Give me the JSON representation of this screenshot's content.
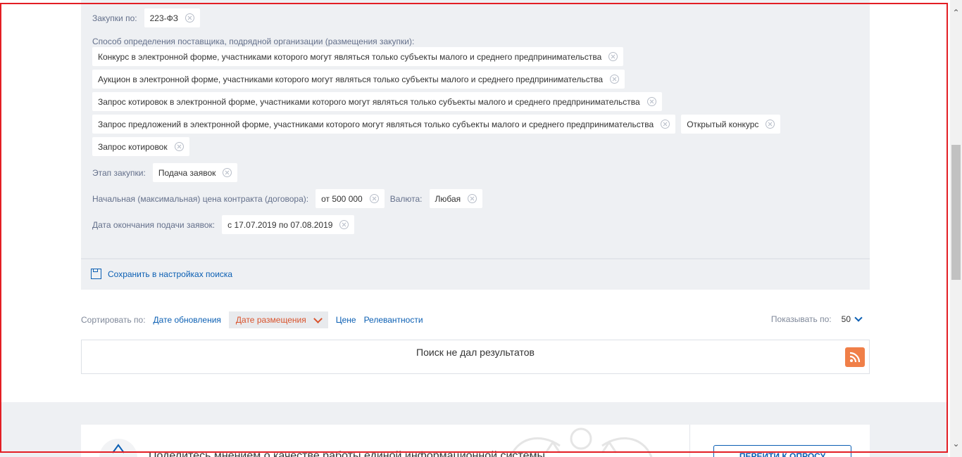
{
  "filters": {
    "purchases_label": "Закупки по:",
    "purchases_chip": "223-ФЗ",
    "method_label": "Способ определения поставщика, подрядной организации (размещения закупки):",
    "method_chips": [
      "Конкурс в электронной форме, участниками которого могут являться только субъекты малого и среднего предпринимательства",
      "Аукцион в электронной форме, участниками которого могут являться только субъекты малого и среднего предпринимательства",
      "Запрос котировок в электронной форме, участниками которого могут являться только субъекты малого и среднего предпринимательства",
      "Запрос предложений в электронной форме, участниками которого могут являться только субъекты малого и среднего предпринимательства",
      "Открытый конкурс",
      "Запрос котировок"
    ],
    "stage_label": "Этап закупки:",
    "stage_chip": "Подача заявок",
    "price_label": "Начальная (максимальная) цена контракта (договора):",
    "price_chip": "от 500 000",
    "currency_label": "Валюта:",
    "currency_chip": "Любая",
    "deadline_label": "Дата окончания подачи заявок:",
    "deadline_chip": "с 17.07.2019 по 07.08.2019",
    "save_link": "Сохранить в настройках поиска"
  },
  "sort": {
    "label": "Сортировать по:",
    "options": [
      "Дате обновления",
      "Дате размещения",
      "Цене",
      "Релевантности"
    ],
    "active_index": 1,
    "show_label": "Показывать по:",
    "show_value": "50"
  },
  "results": {
    "message": "Поиск не дал результатов",
    "rss_icon": "rss-icon"
  },
  "survey": {
    "text": "Поделитесь мнением о качестве работы единой информационной системы",
    "button": "ПЕРЕЙТИ К ОПРОСУ"
  },
  "colors": {
    "accent": "#0b5fb3",
    "active_sort": "#d9532c",
    "rss": "#f07f48",
    "frame": "#e31e24"
  }
}
